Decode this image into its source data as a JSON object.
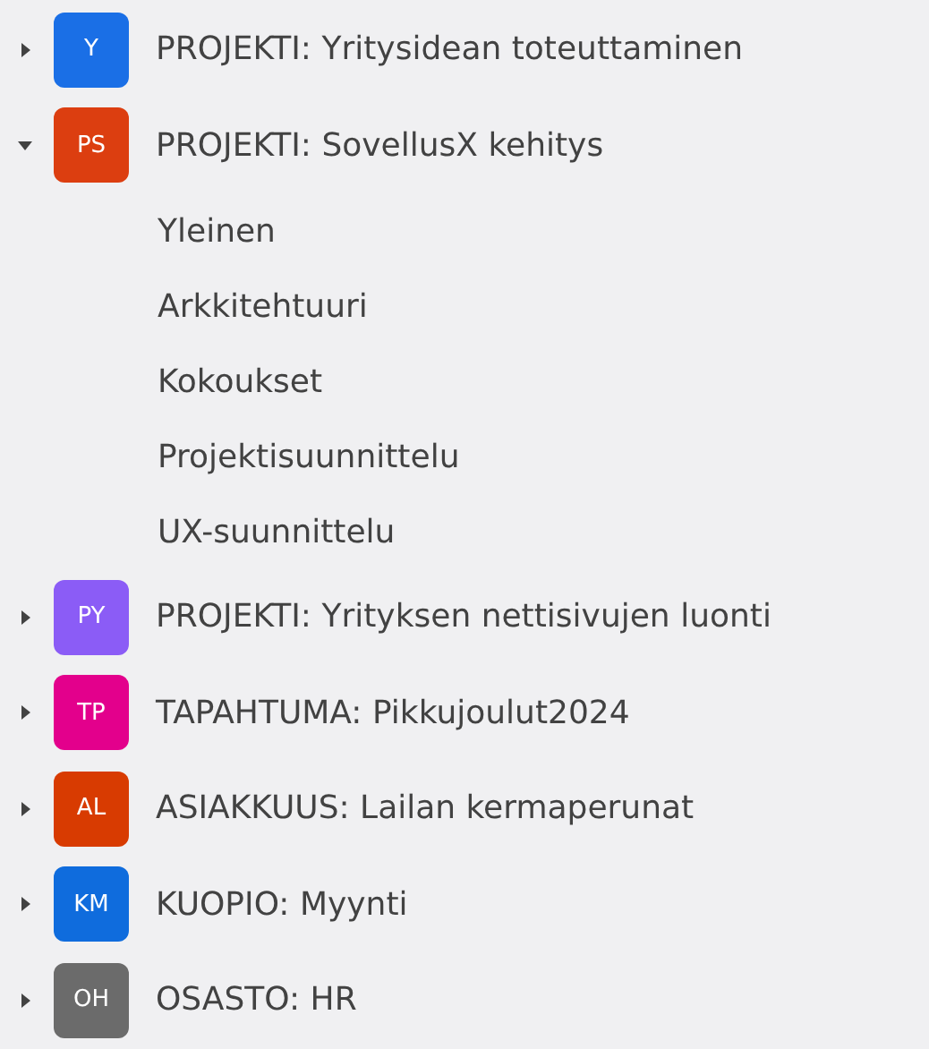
{
  "teams": [
    {
      "initials": "Y",
      "color": "#1a6fe6",
      "name": "PROJEKTI: Yritysidean toteuttaminen",
      "expanded": false
    },
    {
      "initials": "PS",
      "color": "#dc3e10",
      "name": "PROJEKTI: SovellusX kehitys",
      "expanded": true,
      "children": [
        {
          "name": "Yleinen"
        },
        {
          "name": "Arkkitehtuuri"
        },
        {
          "name": "Kokoukset"
        },
        {
          "name": "Projektisuunnittelu"
        },
        {
          "name": "UX-suunnittelu"
        }
      ]
    },
    {
      "initials": "PY",
      "color": "#8b5cf6",
      "name": "PROJEKTI: Yrityksen nettisivujen luonti",
      "expanded": false
    },
    {
      "initials": "TP",
      "color": "#e3008c",
      "name": "TAPAHTUMA: Pikkujoulut2024",
      "expanded": false
    },
    {
      "initials": "AL",
      "color": "#d83b01",
      "name": "ASIAKKUUS: Lailan kermaperunat",
      "expanded": false
    },
    {
      "initials": "KM",
      "color": "#0f6cdd",
      "name": "KUOPIO: Myynti",
      "expanded": false
    },
    {
      "initials": "OH",
      "color": "#6b6b6b",
      "name": "OSASTO: HR",
      "expanded": false
    }
  ]
}
